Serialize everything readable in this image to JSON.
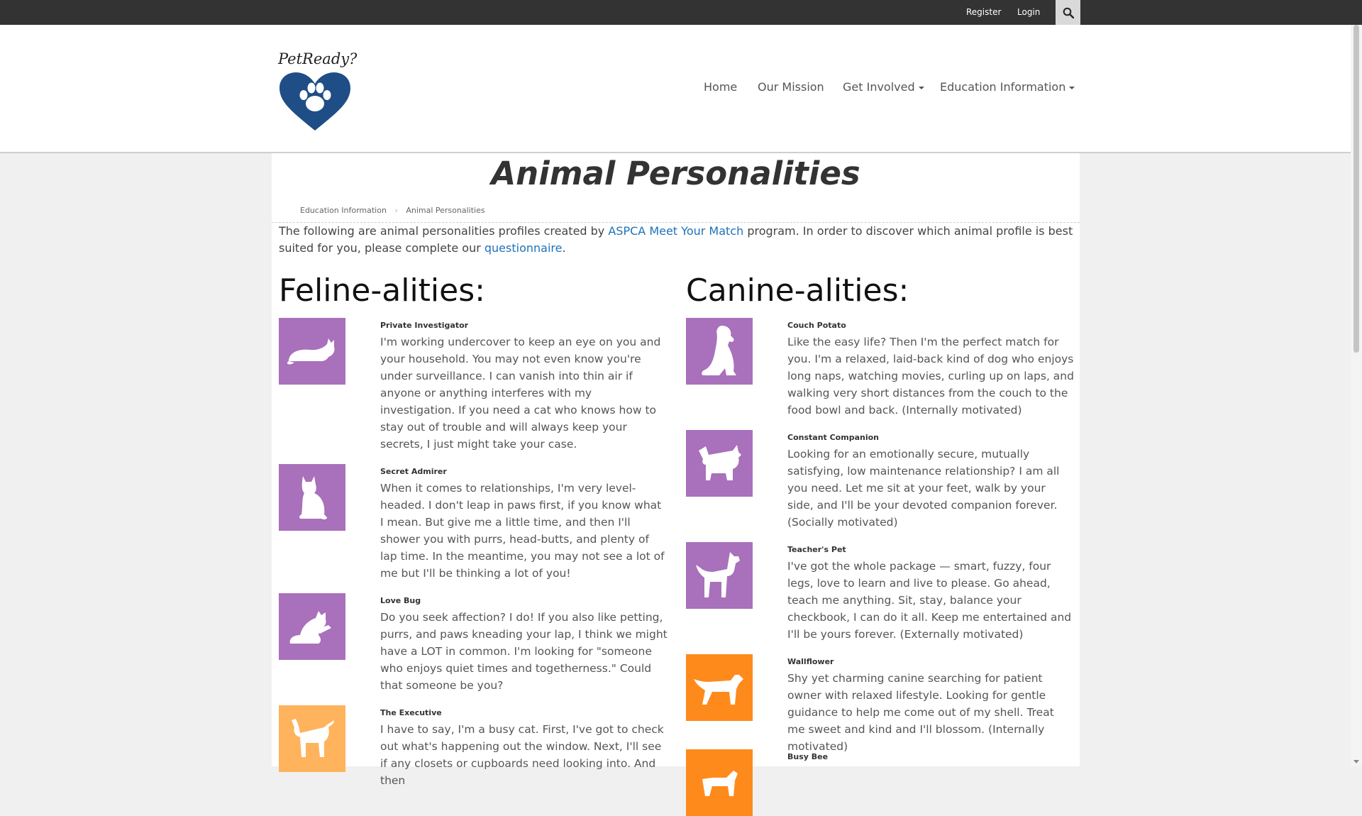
{
  "topbar": {
    "register_label": "Register",
    "login_label": "Login",
    "search_icon": "search-icon"
  },
  "logo": {
    "text": "PetReady?",
    "icon": "heart-paw-icon",
    "color": "#1f4e86"
  },
  "nav": {
    "items": [
      {
        "label": "Home",
        "dropdown": false
      },
      {
        "label": "Our Mission",
        "dropdown": false
      },
      {
        "label": "Get Involved",
        "dropdown": true
      },
      {
        "label": "Education Information",
        "dropdown": true
      }
    ]
  },
  "page": {
    "title": "Animal Personalities",
    "breadcrumb": [
      "Education Information",
      "Animal Personalities"
    ],
    "intro": {
      "before_link1": "The following are animal personalities profiles created by ",
      "link1": "ASPCA Meet Your Match",
      "between": " program. In order to discover which animal profile is best suited for you, please complete our ",
      "link2": "questionnaire",
      "after": "."
    }
  },
  "colors": {
    "purple": "#a970bb",
    "orange": "#ff8a1c",
    "light_orange": "#ffb35c",
    "link": "#1d72b8"
  },
  "feline": {
    "heading": "Feline-alities:",
    "items": [
      {
        "name": "Private Investigator",
        "icon": "lying-cat-icon",
        "color": "purple",
        "desc": "I'm working undercover to keep an eye on you and your household. You may not even know you're under surveillance. I can vanish into thin air if anyone or anything interferes with my investigation. If you need a cat who knows how to stay out of trouble and will always keep your secrets, I just might take your case."
      },
      {
        "name": "Secret Admirer",
        "icon": "sitting-cat-icon",
        "color": "purple",
        "desc": "When it comes to relationships, I'm very level-headed. I don't leap in paws first, if you know what I mean. But give me a little time, and then I'll shower you with purrs, head-butts, and plenty of lap time. In the meantime, you may not see a lot of me but I'll be thinking a lot of you!"
      },
      {
        "name": "Love Bug",
        "icon": "grooming-cat-icon",
        "color": "purple",
        "desc": "Do you seek affection? I do! If you also like petting, purrs, and paws kneading your lap, I think we might have a LOT in common. I'm looking for \"someone who enjoys quiet times and togetherness.\" Could that someone be you?"
      },
      {
        "name": "The Executive",
        "icon": "standing-cat-icon",
        "color": "light-orange",
        "desc": "I have to say, I'm a busy cat. First, I've got to check out what's happening out the window. Next, I'll see if any closets or cupboards need looking into. And then"
      }
    ]
  },
  "canine": {
    "heading": "Canine-alities:",
    "items": [
      {
        "name": "Couch Potato",
        "icon": "sitting-dog-icon",
        "color": "purple",
        "desc": "Like the easy life? Then I'm the perfect match for you. I'm a relaxed, laid-back kind of dog who enjoys long naps, watching movies, curling up on laps, and walking very short distances from the couch to the food bowl and back. (Internally motivated)"
      },
      {
        "name": "Constant Companion",
        "icon": "terrier-icon",
        "color": "purple",
        "desc": "Looking for an emotionally secure, mutually satisfying, low maintenance relationship? I am all you need. Let me sit at your feet, walk by your side, and I'll be your devoted companion forever. (Socially motivated)"
      },
      {
        "name": "Teacher's Pet",
        "icon": "standing-dog-icon",
        "color": "purple",
        "desc": "I've got the whole package — smart, fuzzy, four legs, love to learn and live to please. Go ahead, teach me anything. Sit, stay, balance your checkbook, I can do it all. Keep me entertained and I'll be yours forever. (Externally motivated)"
      },
      {
        "name": "Wallflower",
        "icon": "walking-dog-icon",
        "color": "orange",
        "desc": "Shy yet charming canine searching for patient owner with relaxed lifestyle. Looking for gentle guidance to help me come out of my shell. Treat me sweet and kind and I'll blossom. (Internally motivated)"
      },
      {
        "name": "Busy Bee",
        "icon": "dog-icon",
        "color": "orange",
        "desc": ""
      }
    ]
  }
}
